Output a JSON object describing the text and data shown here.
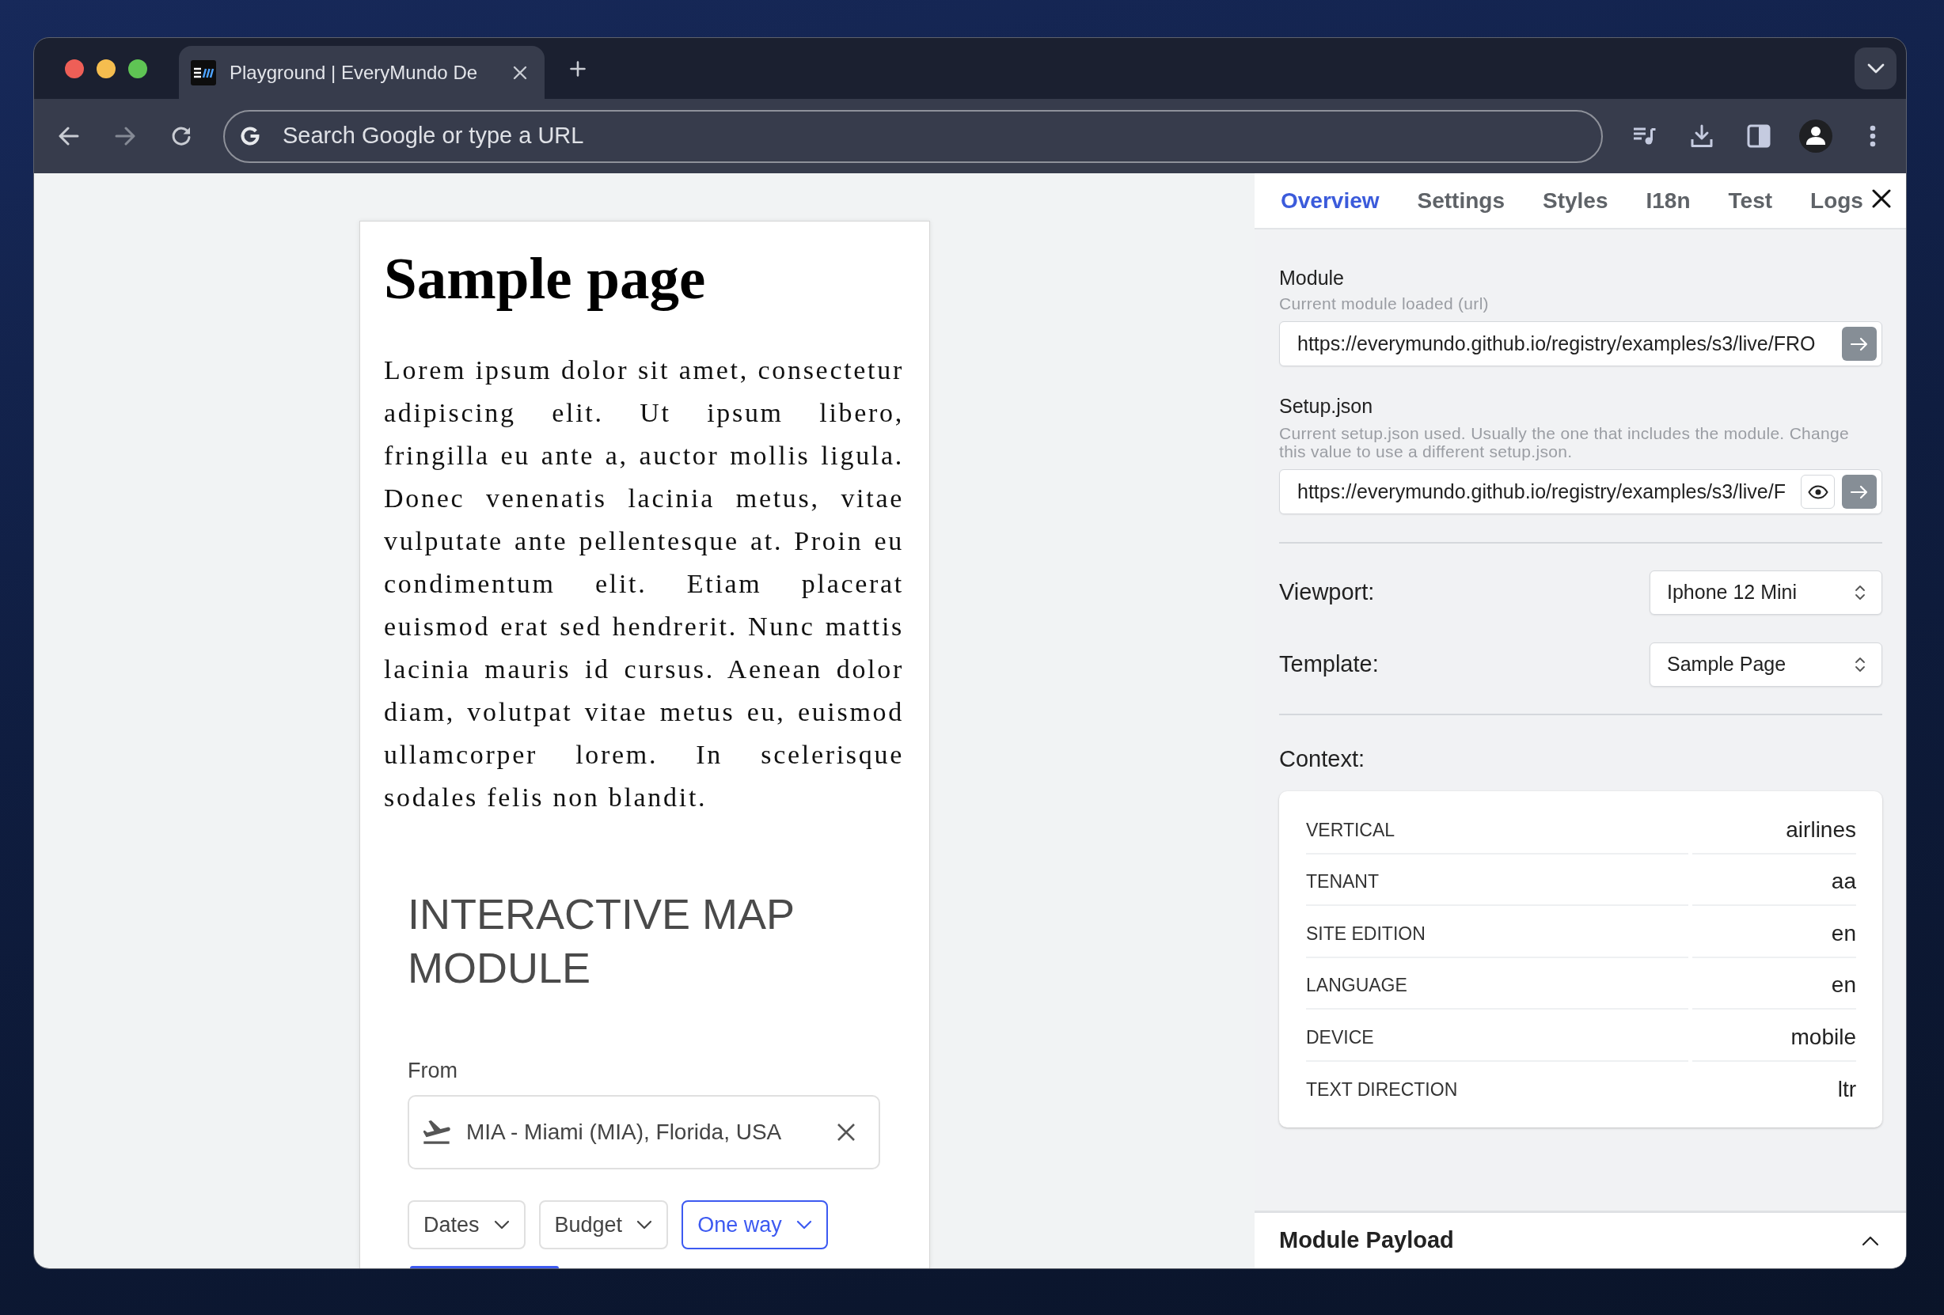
{
  "browser": {
    "tabs": [
      {
        "title": "Playground | EveryMundo De",
        "selected": true
      }
    ],
    "address_bar": {
      "placeholder": "Search Google or type a URL"
    }
  },
  "page": {
    "heading": "Sample page",
    "body": "Lorem ipsum dolor sit amet, consectetur adipiscing elit. Ut ipsum libero, fringilla eu ante a, auctor mollis ligula. Donec venenatis lacinia metus, vitae vulputate ante pellentesque at. Proin eu condimentum elit. Etiam placerat euismod erat sed hendrerit. Nunc mattis lacinia mauris id cursus. Aenean dolor diam, volutpat vitae metus eu, euismod ullamcorper lorem. In scelerisque sodales felis non blandit.",
    "module": {
      "title": "INTERACTIVE MAP MODULE",
      "from": {
        "label": "From",
        "value": "MIA - Miami (MIA), Florida, USA"
      },
      "filters": [
        {
          "label": "Dates",
          "selected": false
        },
        {
          "label": "Budget",
          "selected": false
        },
        {
          "label": "One way",
          "selected": true
        }
      ]
    }
  },
  "panel": {
    "tabs": [
      {
        "label": "Overview",
        "selected": true
      },
      {
        "label": "Settings",
        "selected": false
      },
      {
        "label": "Styles",
        "selected": false
      },
      {
        "label": "I18n",
        "selected": false
      },
      {
        "label": "Test",
        "selected": false
      },
      {
        "label": "Logs",
        "selected": false
      }
    ],
    "fields": [
      {
        "kind": "url",
        "label": "Module",
        "hint": "Current module loaded (url)",
        "value": "https://everymundo.github.io/registry/examples/s3/live/FRO"
      },
      {
        "kind": "url_preview",
        "label": "Setup.json",
        "hint": "Current setup.json used. Usually the one that includes the module. Change this value to use a different setup.json.",
        "value": "https://everymundo.github.io/registry/examples/s3/live/F"
      }
    ],
    "selects": [
      {
        "label": "Viewport:",
        "value": "Iphone 12 Mini"
      },
      {
        "label": "Template:",
        "value": "Sample Page"
      }
    ],
    "context": {
      "title": "Context:",
      "rows": [
        {
          "key": "VERTICAL",
          "value": "airlines"
        },
        {
          "key": "TENANT",
          "value": "aa"
        },
        {
          "key": "SITE EDITION",
          "value": "en"
        },
        {
          "key": "LANGUAGE",
          "value": "en"
        },
        {
          "key": "DEVICE",
          "value": "mobile"
        },
        {
          "key": "TEXT DIRECTION",
          "value": "ltr"
        }
      ]
    },
    "payload": {
      "title": "Module Payload"
    }
  }
}
